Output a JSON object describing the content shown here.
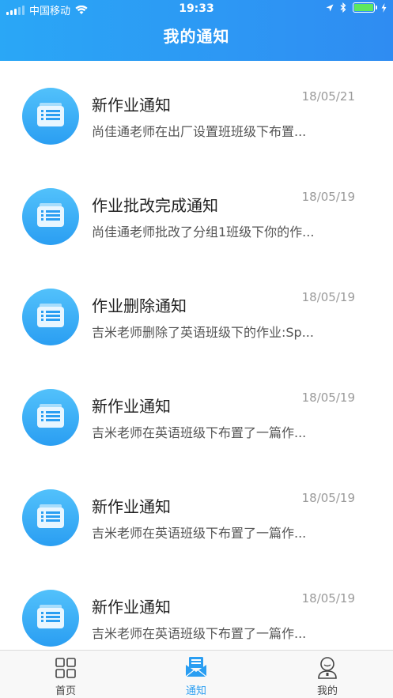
{
  "status_bar": {
    "carrier": "中国移动",
    "time": "19:33"
  },
  "nav": {
    "title": "我的通知"
  },
  "notifications": [
    {
      "title": "新作业通知",
      "date": "18/05/21",
      "desc": "尚佳通老师在出厂设置班班级下布置..."
    },
    {
      "title": "作业批改完成通知",
      "date": "18/05/19",
      "desc": "尚佳通老师批改了分组1班级下你的作..."
    },
    {
      "title": "作业删除通知",
      "date": "18/05/19",
      "desc": "吉米老师删除了英语班级下的作业:Sp..."
    },
    {
      "title": "新作业通知",
      "date": "18/05/19",
      "desc": "吉米老师在英语班级下布置了一篇作..."
    },
    {
      "title": "新作业通知",
      "date": "18/05/19",
      "desc": "吉米老师在英语班级下布置了一篇作..."
    },
    {
      "title": "新作业通知",
      "date": "18/05/19",
      "desc": "吉米老师在英语班级下布置了一篇作..."
    }
  ],
  "tabbar": {
    "tabs": [
      {
        "label": "首页",
        "icon": "grid-icon"
      },
      {
        "label": "通知",
        "icon": "mail-icon",
        "active": true
      },
      {
        "label": "我的",
        "icon": "user-icon"
      }
    ]
  },
  "colors": {
    "accent": "#2a9ef2",
    "header_start": "#2aa7f6",
    "header_end": "#2f8cf2"
  }
}
